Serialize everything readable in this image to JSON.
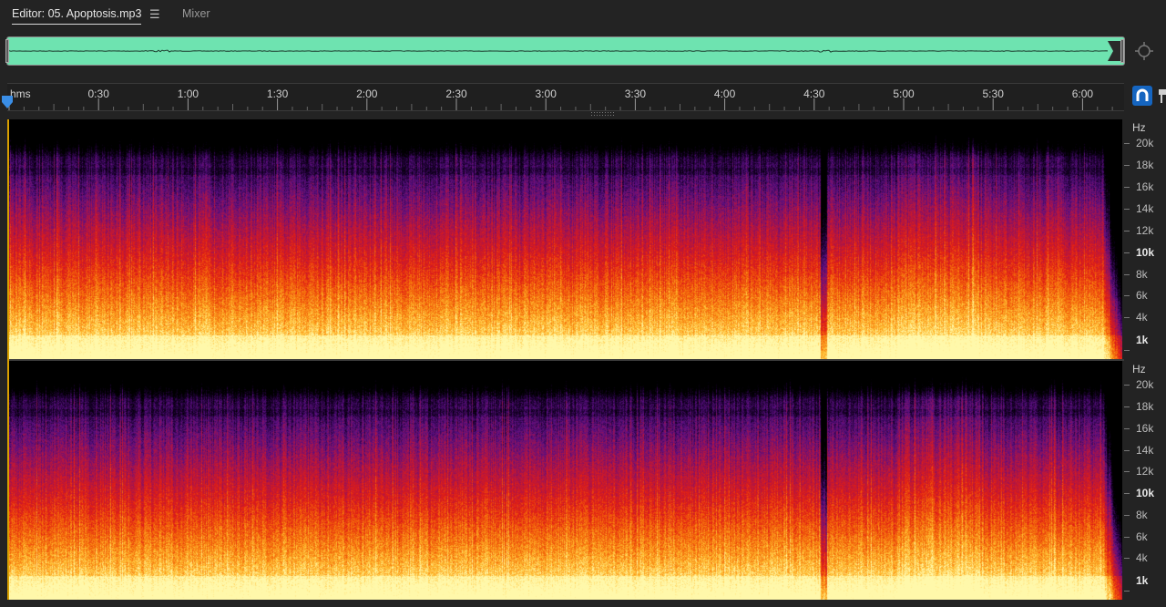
{
  "tabs": {
    "editor_label": "Editor: 05. Apoptosis.mp3",
    "menu_glyph": "☰",
    "mixer_label": "Mixer"
  },
  "ruler": {
    "units_label": "hms",
    "ticks": [
      {
        "label": "0:30",
        "seconds": 30
      },
      {
        "label": "1:00",
        "seconds": 60
      },
      {
        "label": "1:30",
        "seconds": 90
      },
      {
        "label": "2:00",
        "seconds": 120
      },
      {
        "label": "2:30",
        "seconds": 150
      },
      {
        "label": "3:00",
        "seconds": 180
      },
      {
        "label": "3:30",
        "seconds": 210
      },
      {
        "label": "4:00",
        "seconds": 240
      },
      {
        "label": "4:30",
        "seconds": 270
      },
      {
        "label": "5:00",
        "seconds": 300
      },
      {
        "label": "5:30",
        "seconds": 330
      },
      {
        "label": "6:00",
        "seconds": 360
      }
    ],
    "duration_seconds": 374
  },
  "playhead_seconds": 0,
  "frequency_axis": {
    "unit_label": "Hz",
    "max_hz": 22050,
    "labels": [
      {
        "label": "20k",
        "hz": 20000,
        "bold": false
      },
      {
        "label": "18k",
        "hz": 18000,
        "bold": false
      },
      {
        "label": "16k",
        "hz": 16000,
        "bold": false
      },
      {
        "label": "14k",
        "hz": 14000,
        "bold": false
      },
      {
        "label": "12k",
        "hz": 12000,
        "bold": false
      },
      {
        "label": "10k",
        "hz": 10000,
        "bold": true
      },
      {
        "label": "8k",
        "hz": 8000,
        "bold": false
      },
      {
        "label": "6k",
        "hz": 6000,
        "bold": false
      },
      {
        "label": "4k",
        "hz": 4000,
        "bold": false
      },
      {
        "label": "1k",
        "hz": 1000,
        "bold": true
      }
    ]
  },
  "channels": [
    "left",
    "right"
  ],
  "colors": {
    "overview_waveform": "#6ee3b0",
    "snap_button": "#1565c0",
    "playhead": "#3a8ee6",
    "selection_edge": "#d8a000"
  },
  "icons": {
    "zoom": "zoom-navigator-icon",
    "snap": "magnet-icon",
    "marker": "marker-icon",
    "menu": "hamburger-menu-icon"
  }
}
